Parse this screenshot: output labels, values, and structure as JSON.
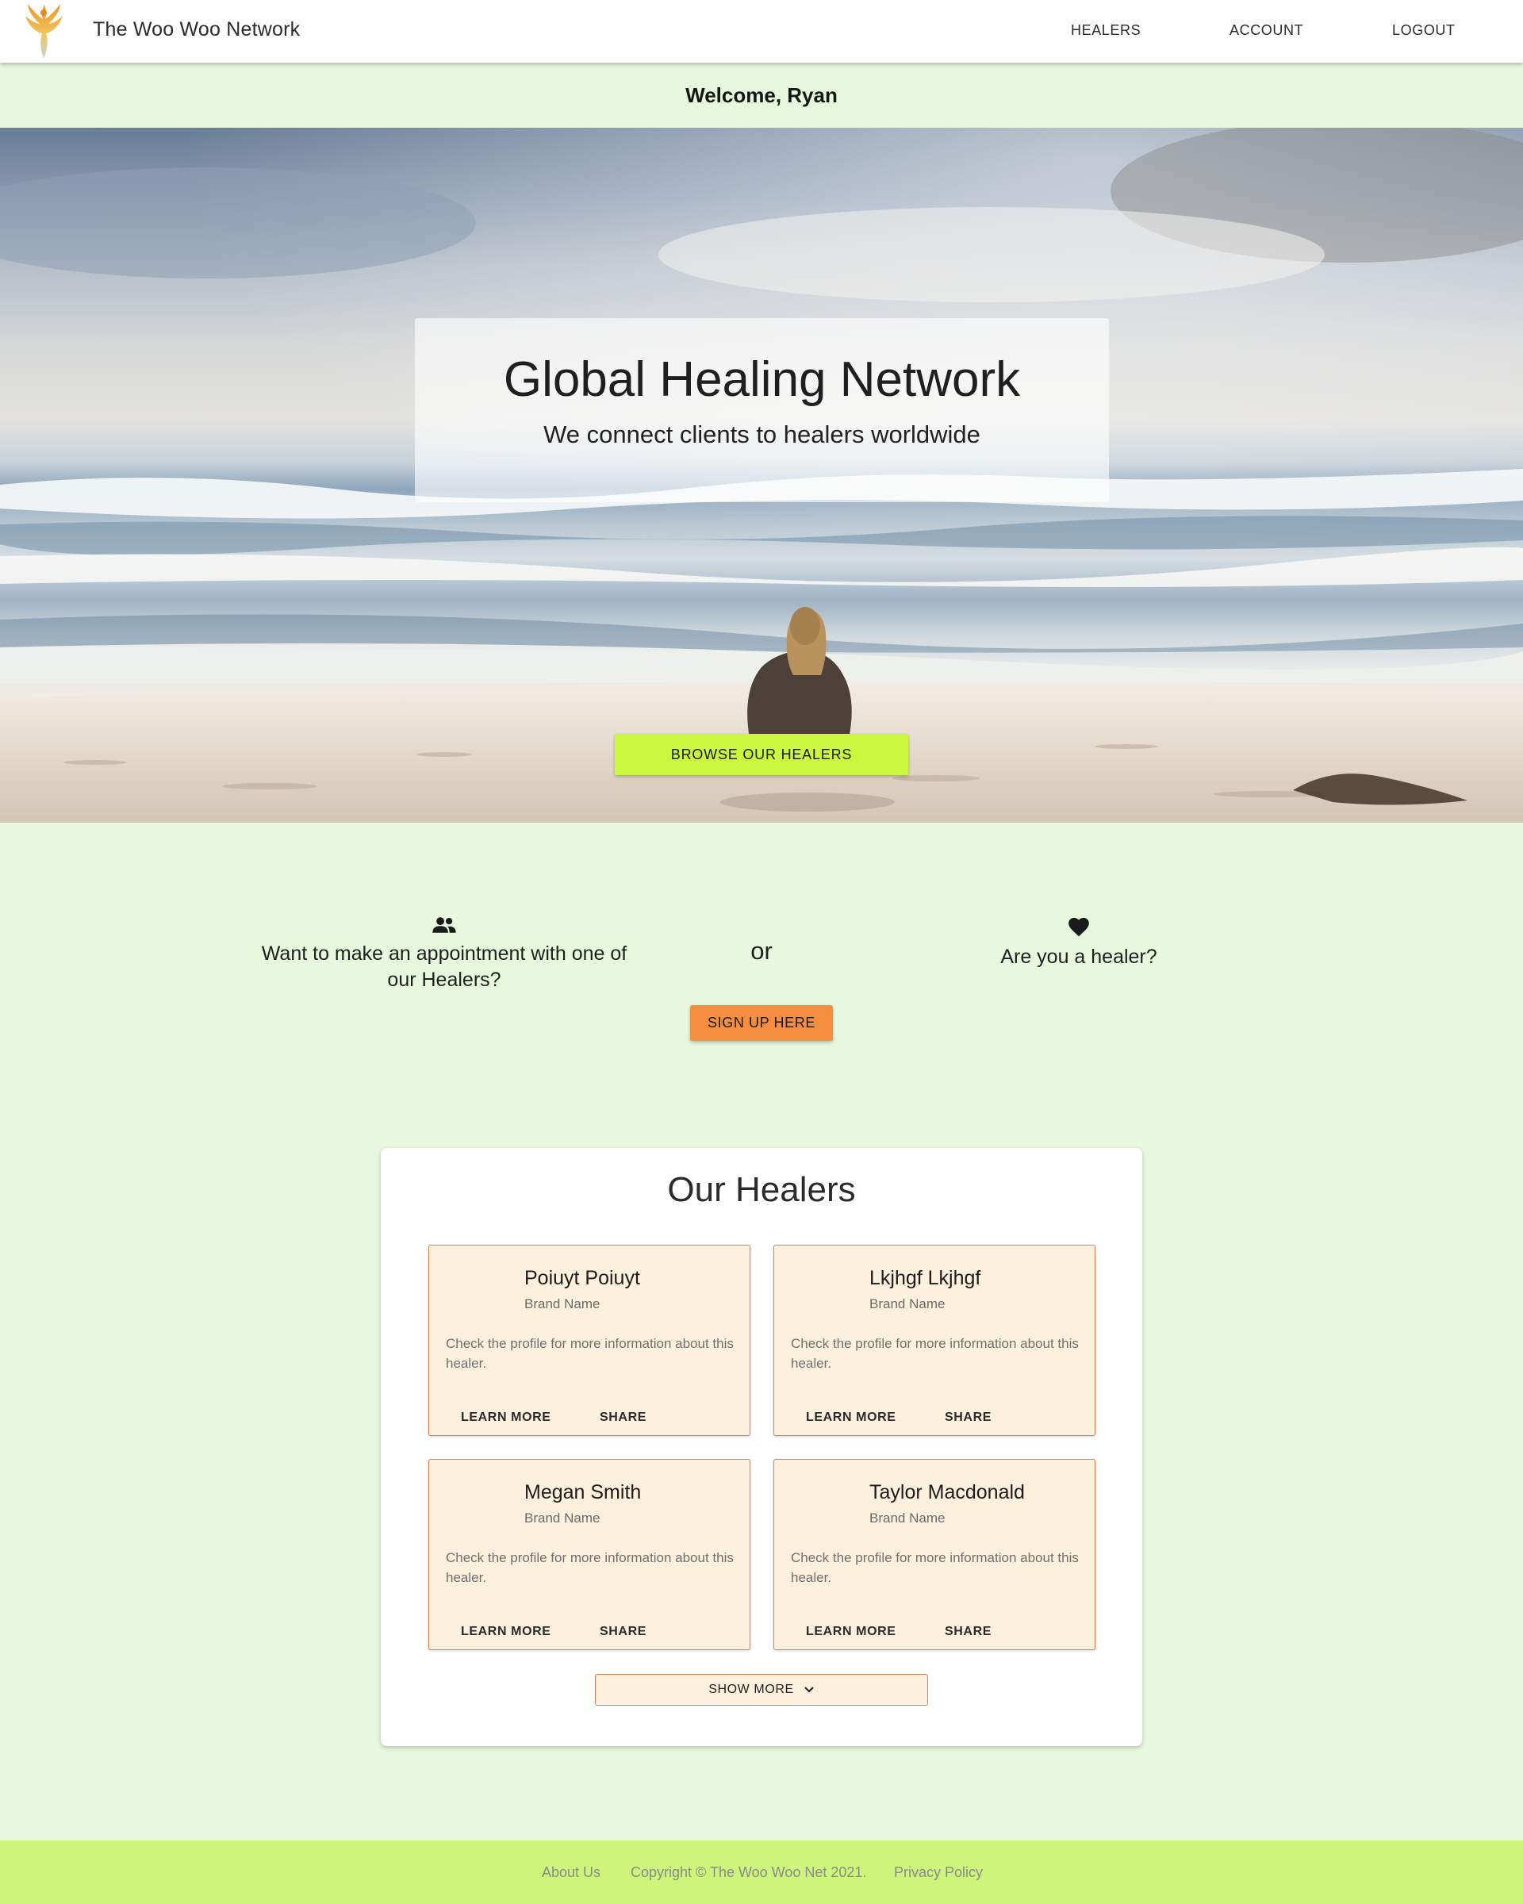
{
  "header": {
    "brand_title": "The Woo Woo Network",
    "logo_icon": "phoenix-logo-icon",
    "nav": {
      "healers": "HEALERS",
      "account": "ACCOUNT",
      "logout": "LOGOUT"
    }
  },
  "welcome": {
    "text": "Welcome, Ryan"
  },
  "hero": {
    "title": "Global Healing Network",
    "subtitle": "We connect clients to healers worldwide",
    "browse_button": "BROWSE OUR HEALERS",
    "image_subject": "beach-meditation-photo"
  },
  "cta": {
    "clients_icon": "people-icon",
    "clients_text": "Want to make an appointment with one of our Healers?",
    "or_text": "or",
    "healer_icon": "heart-icon",
    "healer_text": "Are you a healer?",
    "signup_button": "SIGN UP HERE"
  },
  "healers": {
    "title": "Our Healers",
    "items": [
      {
        "name": "Poiuyt Poiuyt",
        "brand": "Brand Name",
        "description": "Check the profile for more information about this healer.",
        "learn_more": "LEARN MORE",
        "share": "SHARE"
      },
      {
        "name": "Lkjhgf Lkjhgf",
        "brand": "Brand Name",
        "description": "Check the profile for more information about this healer.",
        "learn_more": "LEARN MORE",
        "share": "SHARE"
      },
      {
        "name": "Megan Smith",
        "brand": "Brand Name",
        "description": "Check the profile for more information about this healer.",
        "learn_more": "LEARN MORE",
        "share": "SHARE"
      },
      {
        "name": "Taylor Macdonald",
        "brand": "Brand Name",
        "description": "Check the profile for more information about this healer.",
        "learn_more": "LEARN MORE",
        "share": "SHARE"
      }
    ],
    "show_more": "SHOW MORE"
  },
  "footer": {
    "about": "About Us",
    "copyright": "Copyright © The Woo Woo Net 2021.",
    "privacy": "Privacy Policy"
  },
  "colors": {
    "page_background": "#e7f8dd",
    "browse_button": "#cbf73d",
    "signup_button": "#f58e3f",
    "healer_card": "#fdf0dd",
    "healer_border": "#d9824f",
    "footer": "#cdf57c"
  }
}
